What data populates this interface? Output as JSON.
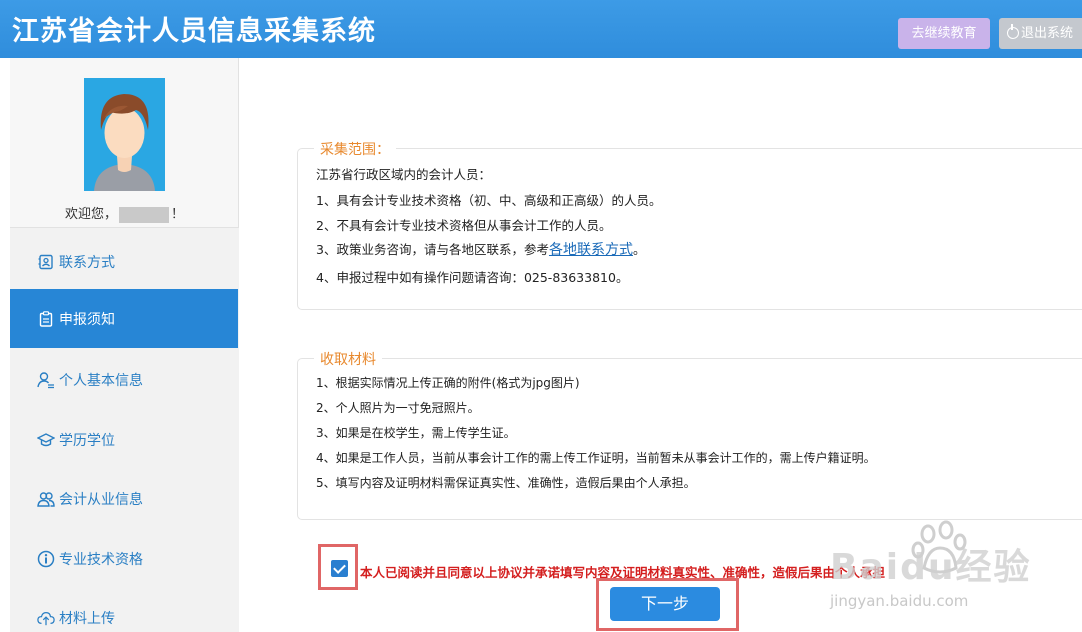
{
  "header": {
    "title": "江苏省会计人员信息采集系统",
    "continuing_edu_label": "去继续教育",
    "logout_label": "退出系统"
  },
  "profile": {
    "greeting_prefix": "欢迎您，",
    "greeting_suffix": "！"
  },
  "sidebar": {
    "items": [
      {
        "label": "联系方式",
        "icon": "contact-card-icon",
        "active": false
      },
      {
        "label": "申报须知",
        "icon": "clipboard-icon",
        "active": true
      },
      {
        "label": "个人基本信息",
        "icon": "user-info-icon",
        "active": false
      },
      {
        "label": "学历学位",
        "icon": "graduation-cap-icon",
        "active": false
      },
      {
        "label": "会计从业信息",
        "icon": "users-icon",
        "active": false
      },
      {
        "label": "专业技术资格",
        "icon": "info-circle-icon",
        "active": false
      },
      {
        "label": "材料上传",
        "icon": "cloud-upload-icon",
        "active": false
      }
    ]
  },
  "scope": {
    "legend": "采集范围：",
    "intro": "江苏省行政区域内的会计人员：",
    "item1": "1、具有会计专业技术资格（初、中、高级和正高级）的人员。",
    "item2": "2、不具有会计专业技术资格但从事会计工作的人员。",
    "item3_prefix": "3、政策业务咨询，请与各地区联系，参考",
    "item3_link": "各地联系方式",
    "item3_suffix": "。",
    "item4": "4、申报过程中如有操作问题请咨询：025-83633810。"
  },
  "materials": {
    "legend": "收取材料",
    "items": [
      "1、根据实际情况上传正确的附件(格式为jpg图片)",
      "2、个人照片为一寸免冠照片。",
      "3、如果是在校学生，需上传学生证。",
      "4、如果是工作人员，当前从事会计工作的需上传工作证明，当前暂未从事会计工作的，需上传户籍证明。",
      "5、填写内容及证明材料需保证真实性、准确性，造假后果由个人承担。"
    ]
  },
  "agreement": {
    "checked": true,
    "text": "本人已阅读并且同意以上协议并承诺填写内容及证明材料真实性、准确性，造假后果由个人承担"
  },
  "next_button_label": "下一步",
  "watermark": {
    "brand": "Baidu经验",
    "url": "jingyan.baidu.com"
  },
  "colors": {
    "header_blue": "#2f8ddc",
    "active_menu": "#2786d6",
    "legend_orange": "#e8892e",
    "warning_red": "#d41f1f",
    "highlight_red": "#e06666"
  }
}
